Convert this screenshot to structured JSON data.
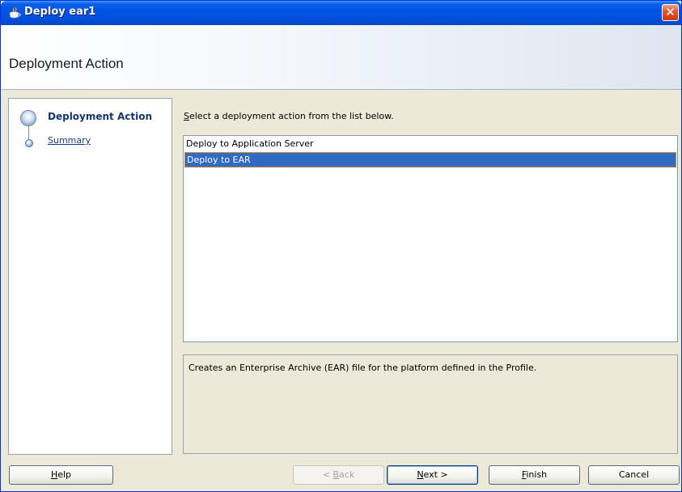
{
  "window": {
    "title": "Deploy ear1",
    "icon": "java-cup-icon",
    "close_glyph": "✕"
  },
  "header": {
    "title": "Deployment Action"
  },
  "nav": {
    "steps": [
      {
        "label": "Deployment Action",
        "state": "current"
      },
      {
        "label": "Summary",
        "state": "link"
      }
    ]
  },
  "content": {
    "instruction_mnemonic": "S",
    "instruction_rest": "elect a deployment action from the list below.",
    "actions": [
      {
        "label": "Deploy to Application Server",
        "selected": false
      },
      {
        "label": "Deploy to EAR",
        "selected": true
      }
    ],
    "description": "Creates an Enterprise Archive (EAR) file for the platform defined in the Profile."
  },
  "buttons": {
    "help_mnemonic": "H",
    "help_rest": "elp",
    "back_prefix": "< ",
    "back_mnemonic": "B",
    "back_rest": "ack",
    "next_mnemonic": "N",
    "next_rest": "ext >",
    "finish_mnemonic": "F",
    "finish_rest": "inish",
    "cancel": "Cancel"
  },
  "colors": {
    "titlebar": "#0054e3",
    "selection": "#316ac5",
    "dialog_bg": "#ece9d8"
  }
}
